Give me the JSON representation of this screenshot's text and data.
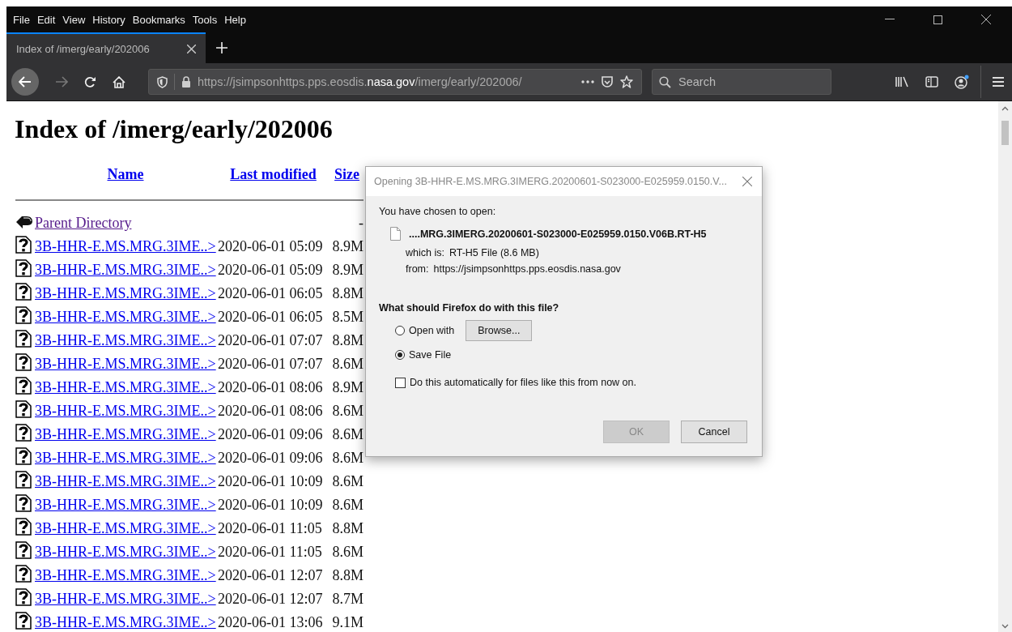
{
  "menu": [
    "File",
    "Edit",
    "View",
    "History",
    "Bookmarks",
    "Tools",
    "Help"
  ],
  "tabs": [
    {
      "title": "Index of /imerg/early/202006",
      "selected": true
    }
  ],
  "address": {
    "prefix": "https://jsimpsonhttps.pps.eosdis.",
    "domain": "nasa.gov",
    "suffix": "/imerg/early/202006/"
  },
  "search": {
    "placeholder": "Search"
  },
  "page": {
    "heading": "Index of /imerg/early/202006",
    "columns": [
      "Name",
      "Last modified",
      "Size"
    ],
    "parent": {
      "name": "Parent Directory",
      "size": "-"
    },
    "rows": [
      {
        "name": "3B-HHR-E.MS.MRG.3IME..>",
        "modified": "2020-06-01 05:09",
        "size": "8.9M"
      },
      {
        "name": "3B-HHR-E.MS.MRG.3IME..>",
        "modified": "2020-06-01 05:09",
        "size": "8.9M"
      },
      {
        "name": "3B-HHR-E.MS.MRG.3IME..>",
        "modified": "2020-06-01 06:05",
        "size": "8.8M"
      },
      {
        "name": "3B-HHR-E.MS.MRG.3IME..>",
        "modified": "2020-06-01 06:05",
        "size": "8.5M"
      },
      {
        "name": "3B-HHR-E.MS.MRG.3IME..>",
        "modified": "2020-06-01 07:07",
        "size": "8.8M"
      },
      {
        "name": "3B-HHR-E.MS.MRG.3IME..>",
        "modified": "2020-06-01 07:07",
        "size": "8.6M"
      },
      {
        "name": "3B-HHR-E.MS.MRG.3IME..>",
        "modified": "2020-06-01 08:06",
        "size": "8.9M"
      },
      {
        "name": "3B-HHR-E.MS.MRG.3IME..>",
        "modified": "2020-06-01 08:06",
        "size": "8.6M"
      },
      {
        "name": "3B-HHR-E.MS.MRG.3IME..>",
        "modified": "2020-06-01 09:06",
        "size": "8.6M"
      },
      {
        "name": "3B-HHR-E.MS.MRG.3IME..>",
        "modified": "2020-06-01 09:06",
        "size": "8.6M"
      },
      {
        "name": "3B-HHR-E.MS.MRG.3IME..>",
        "modified": "2020-06-01 10:09",
        "size": "8.6M"
      },
      {
        "name": "3B-HHR-E.MS.MRG.3IME..>",
        "modified": "2020-06-01 10:09",
        "size": "8.6M"
      },
      {
        "name": "3B-HHR-E.MS.MRG.3IME..>",
        "modified": "2020-06-01 11:05",
        "size": "8.8M"
      },
      {
        "name": "3B-HHR-E.MS.MRG.3IME..>",
        "modified": "2020-06-01 11:05",
        "size": "8.6M"
      },
      {
        "name": "3B-HHR-E.MS.MRG.3IME..>",
        "modified": "2020-06-01 12:07",
        "size": "8.8M"
      },
      {
        "name": "3B-HHR-E.MS.MRG.3IME..>",
        "modified": "2020-06-01 12:07",
        "size": "8.7M"
      },
      {
        "name": "3B-HHR-E.MS.MRG.3IME..>",
        "modified": "2020-06-01 13:06",
        "size": "9.1M"
      }
    ]
  },
  "dialog": {
    "title": "Opening 3B-HHR-E.MS.MRG.3IMERG.20200601-S023000-E025959.0150.V...",
    "intro": "You have chosen to open:",
    "filename": "....MRG.3IMERG.20200601-S023000-E025959.0150.V06B.RT-H5",
    "which_label": "which is:",
    "which_value": "RT-H5 File (8.6 MB)",
    "from_label": "from:",
    "from_value": "https://jsimpsonhttps.pps.eosdis.nasa.gov",
    "question": "What should Firefox do with this file?",
    "options": [
      {
        "label": "Open with",
        "selected": false
      },
      {
        "label": "Save File",
        "selected": true
      }
    ],
    "browse": "Browse...",
    "auto": {
      "label": "Do this automatically for files like this from now on.",
      "checked": false
    },
    "buttons": [
      {
        "label": "OK",
        "disabled": true
      },
      {
        "label": "Cancel",
        "disabled": false
      }
    ]
  }
}
